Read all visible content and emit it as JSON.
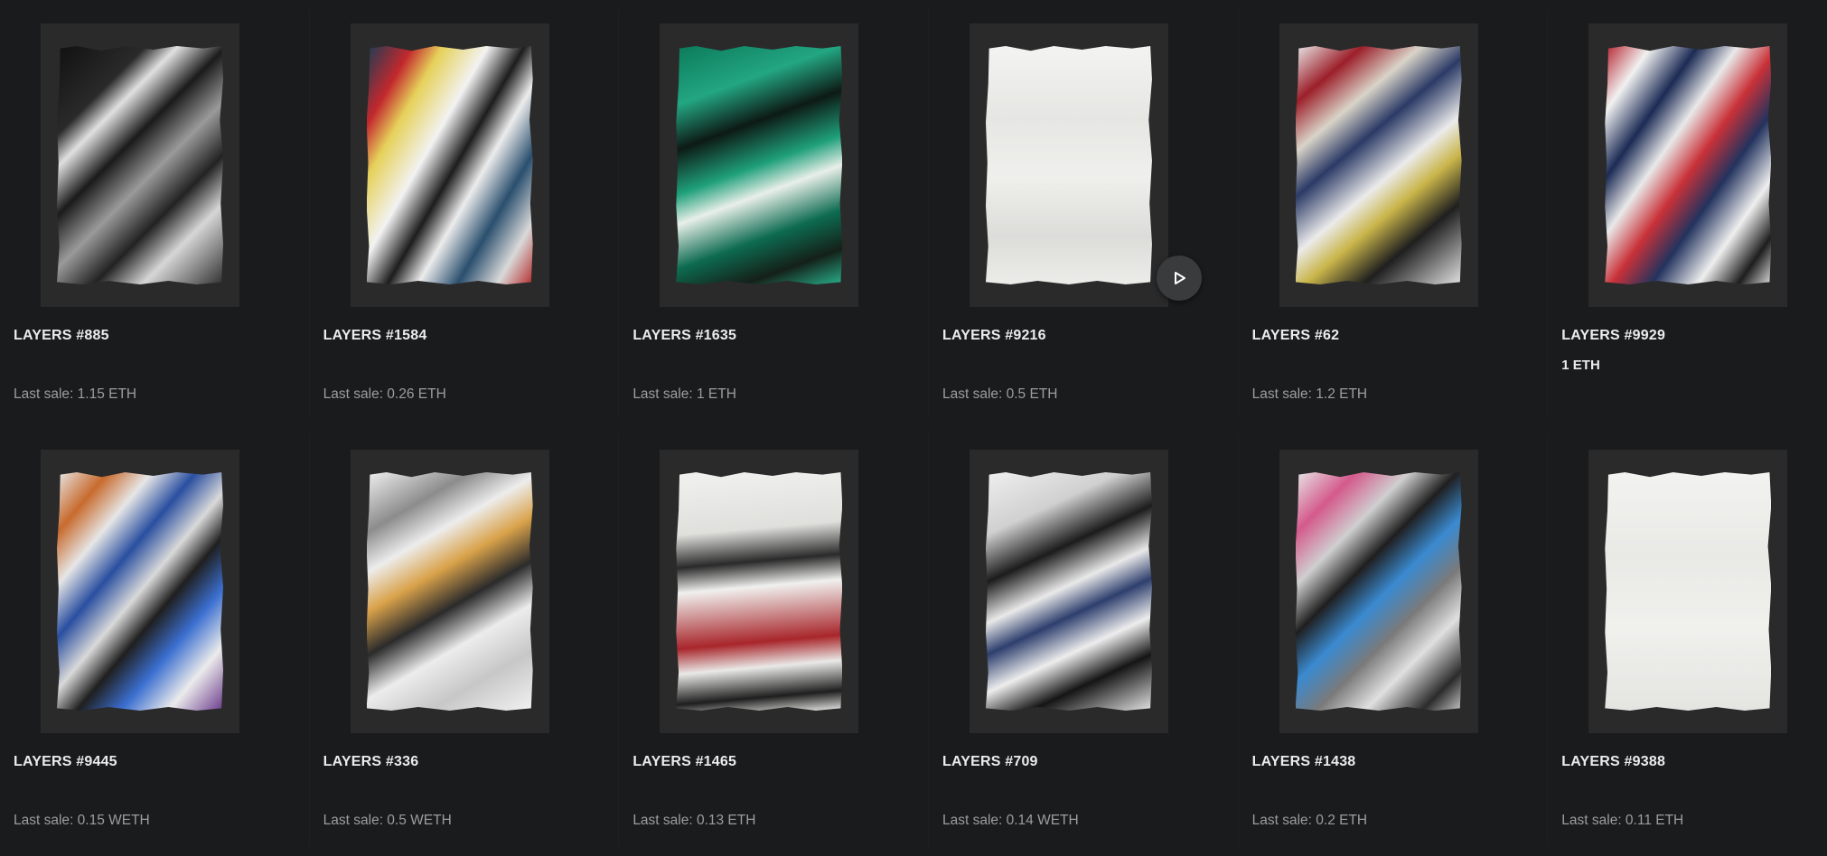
{
  "items": [
    {
      "title": "LAYERS #885",
      "sale": "Last sale: 1.15 ETH",
      "poster_bg": "linear-gradient(135deg,#111 0%,#2a2a2a 22%,#e0e0e0 30%,#1b1b1b 42%,#9a9a9a 55%,#222 68%,#d6d6d6 80%,#303030 100%)"
    },
    {
      "title": "LAYERS #1584",
      "sale": "Last sale: 0.26 ETH",
      "poster_bg": "linear-gradient(120deg,#1a3d55 0%,#c2282d 15%,#e6d15a 25%,#f2f2f2 40%,#1d1d1d 52%,#ececec 62%,#2a4f6e 75%,#d9d9d9 88%,#b52a2a 100%)"
    },
    {
      "title": "LAYERS #1635",
      "sale": "Last sale: 1 ETH",
      "poster_bg": "linear-gradient(160deg,#0b7a5a 0%,#23a682 20%,#0d1a15 35%,#1fa07a 50%,#e8efe9 60%,#0d6b50 75%,#142019 88%,#28b08a 100%)"
    },
    {
      "title": "LAYERS #9216",
      "sale": "Last sale: 0.5 ETH",
      "poster_bg": "linear-gradient(180deg,#f3f3f1 0%,#e6e6e3 30%,#efefec 55%,#dcdcd9 80%,#ecece9 100%)"
    },
    {
      "title": "LAYERS #62",
      "sale": "Last sale: 1.2 ETH",
      "poster_bg": "linear-gradient(140deg,#e9e9e9 0%,#9c1f2a 15%,#d9d4c8 28%,#2b3a66 40%,#ebebeb 55%,#c9b54a 65%,#1f1f1f 78%,#e4e4e4 100%)"
    },
    {
      "title": "LAYERS #9929",
      "sale": "",
      "price": "1 ETH",
      "poster_bg": "linear-gradient(125deg,#b3202a 0%,#f1f1f1 14%,#1c2b55 28%,#e9e9e9 40%,#c93138 52%,#23335e 64%,#efefef 78%,#1e1e1e 90%,#dcdcdc 100%)"
    },
    {
      "title": "LAYERS #9445",
      "sale": "Last sale: 0.15 WETH",
      "poster_bg": "linear-gradient(130deg,#e8e8e8 0%,#c86b2e 14%,#e6e6e6 26%,#2a4fa0 38%,#d9d9d9 50%,#1f1f1f 60%,#3b6fd0 72%,#ebebeb 85%,#6a3a8c 100%)"
    },
    {
      "title": "LAYERS #336",
      "sale": "Last sale: 0.5 WETH",
      "poster_bg": "linear-gradient(150deg,#f0f0f0 0%,#8c8c8c 18%,#ededed 30%,#d9a24a 42%,#2b2b2b 55%,#ececec 68%,#c7c7c7 82%,#f2f2f2 100%)"
    },
    {
      "title": "LAYERS #1465",
      "sale": "Last sale: 0.13 ETH",
      "poster_bg": "linear-gradient(175deg,#f1f1ef 0%,#dfdfdc 25%,#2a2a2a 38%,#f0f0ee 48%,#a8262b 70%,#e9e9e7 80%,#1e1e1e 92%,#eaeae8 100%)"
    },
    {
      "title": "LAYERS #709",
      "sale": "Last sale: 0.14 WETH",
      "poster_bg": "linear-gradient(155deg,#efefef 0%,#d0d0d0 20%,#1c1c1c 35%,#e9e9e9 48%,#2e3f6e 58%,#ededed 70%,#151515 82%,#e5e5e5 100%)"
    },
    {
      "title": "LAYERS #1438",
      "sale": "Last sale: 0.2 ETH",
      "poster_bg": "linear-gradient(135deg,#e7e7e7 0%,#d45a8c 15%,#cfcfcf 28%,#1f1f1f 40%,#3a8ad0 52%,#7a7a7a 64%,#e0e0e0 76%,#2b2b2b 90%,#c8c8c8 100%)"
    },
    {
      "title": "LAYERS #9388",
      "sale": "Last sale: 0.11 ETH",
      "poster_bg": "linear-gradient(180deg,#f2f2f0 0%,#e9e9e6 35%,#f0f0ed 65%,#e4e4e1 100%)"
    }
  ],
  "play_icon": "play-icon"
}
